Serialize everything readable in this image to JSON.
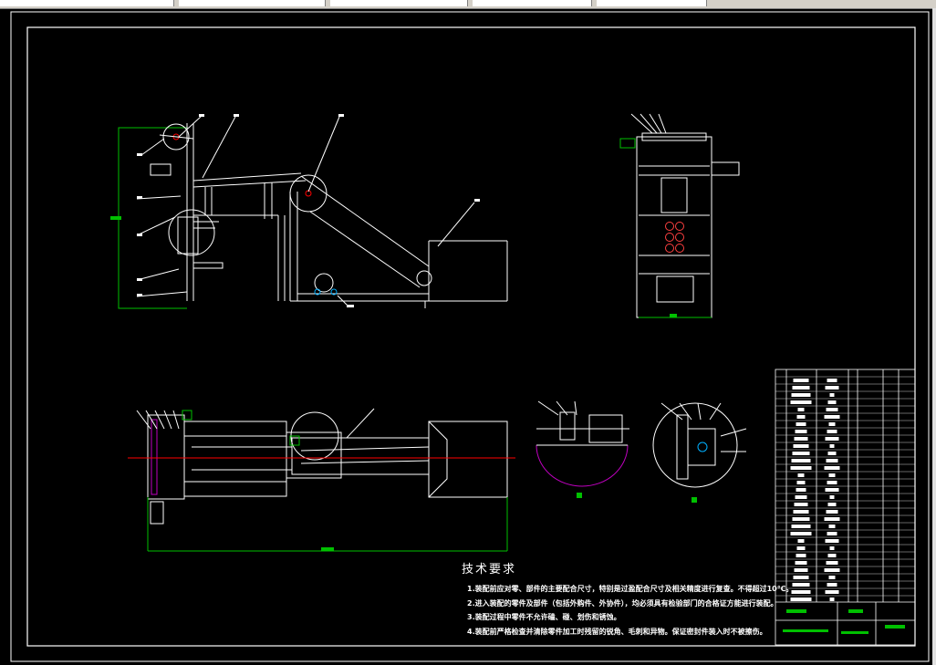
{
  "technical_requirements": {
    "title": "技术要求",
    "items": [
      "1.装配前应对零、部件的主要配合尺寸，特别是过盈配合尺寸及相关精度进行复查。不得超过10℃。",
      "2.进入装配的零件及部件（包括外购件、外协件），均必须具有检验部门的合格证方能进行装配。",
      "3.装配过程中零件不允许磕、碰、划伤和锈蚀。",
      "4.装配前严格检查并清除零件加工时残留的锐角、毛刺和异物。保证密封件装入时不被擦伤。"
    ]
  },
  "colors": {
    "background": "#000000",
    "frame": "#ffffff",
    "dimension": "#00c000",
    "center_line": "#ff0000",
    "hatch": "#c000c0",
    "callout": "#00b0ff"
  }
}
